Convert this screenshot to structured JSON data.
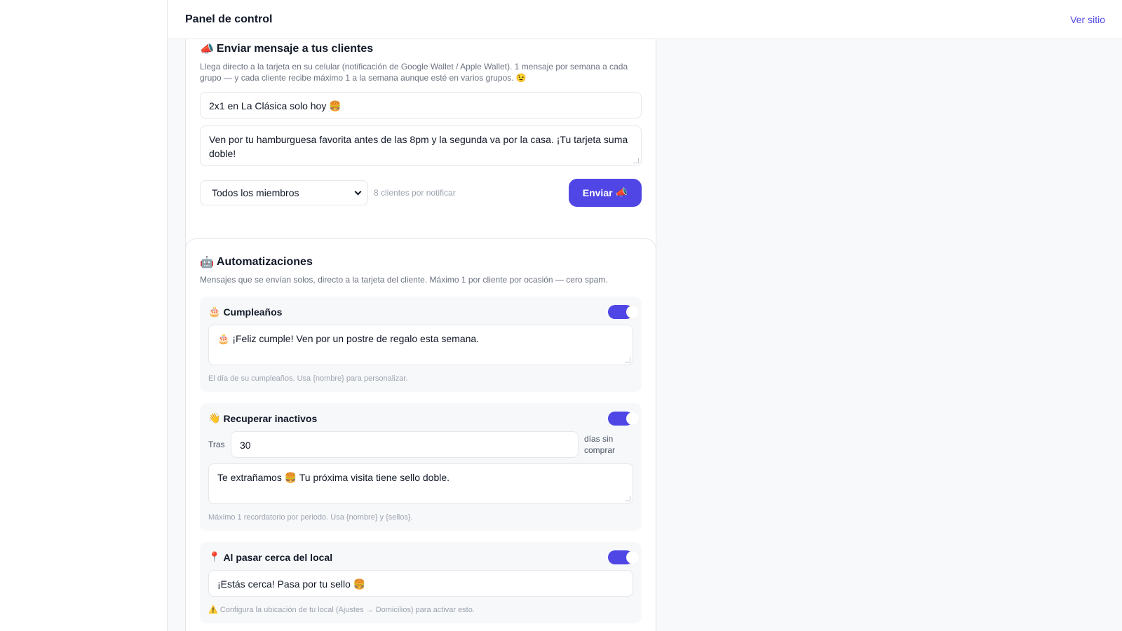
{
  "topbar": {
    "title": "Panel de control",
    "link": "Ver sitio"
  },
  "send": {
    "icon": "📣",
    "title": "Enviar mensaje a tus clientes",
    "description": "Llega directo a la tarjeta en su celular (notificación de Google Wallet / Apple Wallet). 1 mensaje por semana a cada grupo — y cada cliente recibe máximo 1 a la semana aunque esté en varios grupos. 😉",
    "message_title": "2x1 en La Clásica solo hoy 🍔",
    "message_body": "Ven por tu hamburguesa favorita antes de las 8pm y la segunda va por la casa. ¡Tu tarjeta suma doble!",
    "audience": "Todos los miembros",
    "count": "8 clientes por notificar",
    "button_label": "Enviar",
    "button_icon": "📣"
  },
  "automations": {
    "icon": "🤖",
    "title": "Automatizaciones",
    "description": "Mensajes que se envían solos, directo a la tarjeta del cliente. Máximo 1 por cliente por ocasión — cero spam.",
    "birthday": {
      "icon": "🎂",
      "name": "Cumpleaños",
      "enabled": true,
      "message": "🎂 ¡Feliz cumple! Ven por un postre de regalo esta semana.",
      "hint": "El día de su cumpleaños. Usa {nombre} para personalizar."
    },
    "inactive": {
      "icon": "👋",
      "name": "Recuperar inactivos",
      "enabled": true,
      "prefix": "Tras",
      "days": "30",
      "suffix": "días sin comprar",
      "message": "Te extrañamos 🍔 Tu próxima visita tiene sello doble.",
      "hint": "Máximo 1 recordatorio por periodo. Usa {nombre} y {sellos}."
    },
    "nearby": {
      "icon": "📍",
      "name": "Al pasar cerca del local",
      "enabled": true,
      "message": "¡Estás cerca! Pasa por tu sello 🍔",
      "hint": "⚠️ Configura la ubicación de tu local (Ajustes → Domicilios) para activar esto."
    }
  },
  "colors": {
    "accent": "#4f46e5",
    "background": "#f8f9fb"
  }
}
